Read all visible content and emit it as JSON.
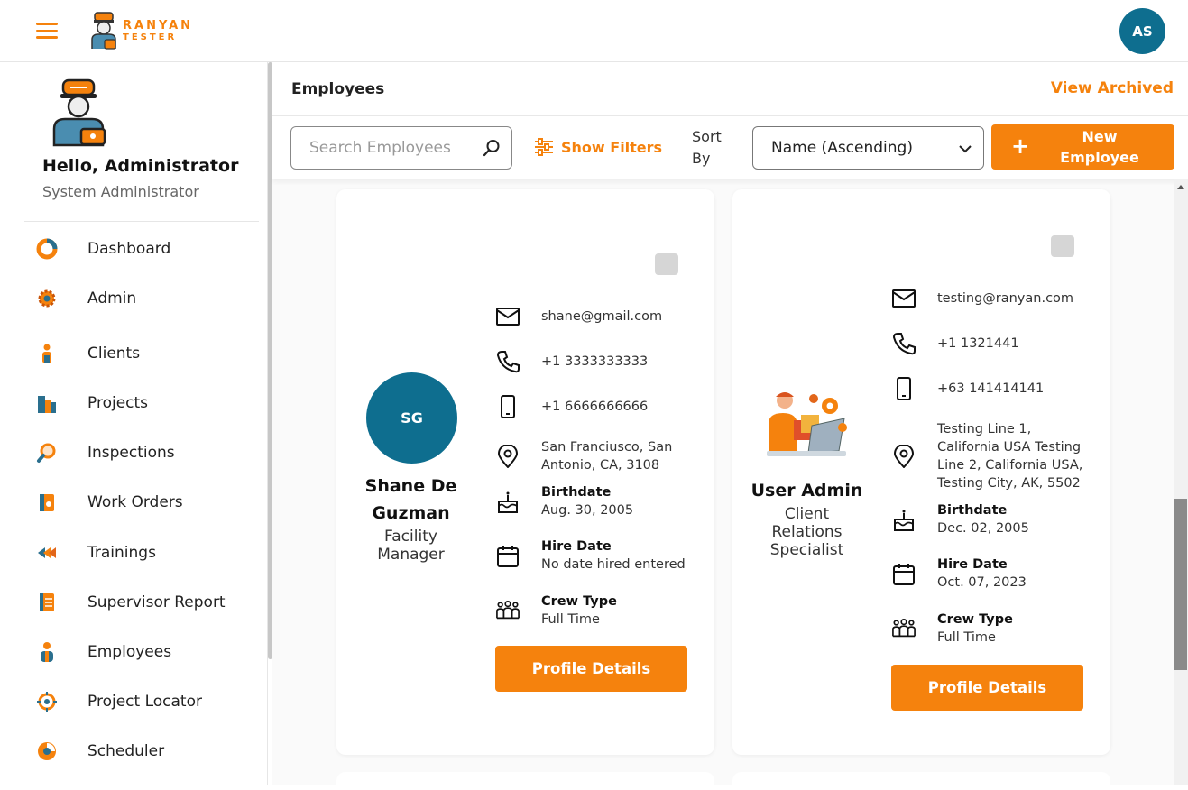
{
  "app": {
    "logo_line1": "RANYAN",
    "logo_line2": "TESTER",
    "user_initials": "AS"
  },
  "sidebar": {
    "greeting": "Hello, Administrator",
    "role": "System Administrator",
    "items": [
      {
        "label": "Dashboard",
        "icon": "dashboard-icon"
      },
      {
        "label": "Admin",
        "icon": "gear-icon"
      },
      {
        "label": "Clients",
        "icon": "client-icon"
      },
      {
        "label": "Projects",
        "icon": "buildings-icon"
      },
      {
        "label": "Inspections",
        "icon": "magnifier-icon"
      },
      {
        "label": "Work Orders",
        "icon": "work-order-icon"
      },
      {
        "label": "Trainings",
        "icon": "training-icon"
      },
      {
        "label": "Supervisor Report",
        "icon": "report-icon"
      },
      {
        "label": "Employees",
        "icon": "employees-icon"
      },
      {
        "label": "Project Locator",
        "icon": "locator-icon"
      },
      {
        "label": "Scheduler",
        "icon": "scheduler-icon"
      }
    ]
  },
  "header": {
    "title": "Employees",
    "view_archived": "View Archived"
  },
  "toolbar": {
    "search_placeholder": "Search Employees",
    "show_filters": "Show Filters",
    "sort_by_1": "Sort",
    "sort_by_2": "By",
    "sort_value": "Name (Ascending)",
    "new_1": "New",
    "new_2": "Employee"
  },
  "employees": [
    {
      "initials": "SG",
      "name_1": "Shane De",
      "name_2": "Guzman",
      "role_1": "Facility",
      "role_2": "Manager",
      "email": "shane@gmail.com",
      "phone": "+1 3333333333",
      "mobile": "+1 6666666666",
      "address_1": "San Franciusco, San",
      "address_2": "Antonio, CA, 3108",
      "birthdate_label": "Birthdate",
      "birthdate": "Aug. 30, 2005",
      "hire_label": "Hire Date",
      "hire_date": "No date hired entered",
      "crew_label": "Crew Type",
      "crew_type": "Full Time",
      "button": "Profile Details"
    },
    {
      "name": "User Admin",
      "role_1": "Client",
      "role_2": "Relations",
      "role_3": "Specialist",
      "email": "testing@ranyan.com",
      "phone": "+1 1321441",
      "mobile": "+63 141414141",
      "address_1": "Testing Line 1,",
      "address_2": "California USA Testing",
      "address_3": "Line 2, California USA,",
      "address_4": "Testing City, AK, 5502",
      "birthdate_label": "Birthdate",
      "birthdate": "Dec. 02, 2005",
      "hire_label": "Hire Date",
      "hire_date": "Oct. 07, 2023",
      "crew_label": "Crew Type",
      "crew_type": "Full Time",
      "button": "Profile Details"
    }
  ],
  "colors": {
    "accent": "#f5820d",
    "avatar": "#0e6e8f"
  }
}
